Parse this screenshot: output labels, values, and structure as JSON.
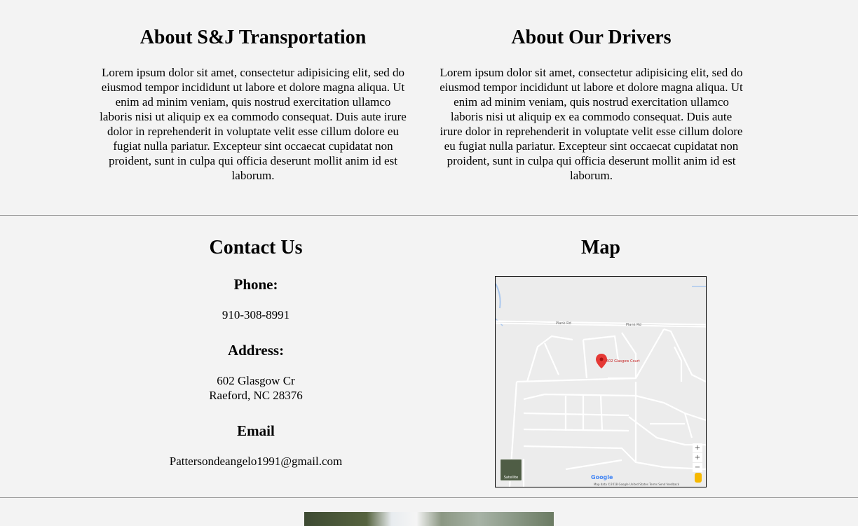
{
  "about": {
    "left_title": "About S&J Transportation",
    "left_text": "Lorem ipsum dolor sit amet, consectetur adipisicing elit, sed do eiusmod tempor incididunt ut labore et dolore magna aliqua. Ut enim ad minim veniam, quis nostrud exercitation ullamco laboris nisi ut aliquip ex ea commodo consequat. Duis aute irure dolor in reprehenderit in voluptate velit esse cillum dolore eu fugiat nulla pariatur. Excepteur sint occaecat cupidatat non proident, sunt in culpa qui officia deserunt mollit anim id est laborum.",
    "right_title": "About Our Drivers",
    "right_text": "Lorem ipsum dolor sit amet, consectetur adipisicing elit, sed do eiusmod tempor incididunt ut labore et dolore magna aliqua. Ut enim ad minim veniam, quis nostrud exercitation ullamco laboris nisi ut aliquip ex ea commodo consequat. Duis aute irure dolor in reprehenderit in voluptate velit esse cillum dolore eu fugiat nulla pariatur. Excepteur sint occaecat cupidatat non proident, sunt in culpa qui officia deserunt mollit anim id est laborum."
  },
  "contact": {
    "title": "Contact Us",
    "phone_label": "Phone:",
    "phone": "910-308-8991",
    "address_label": "Address:",
    "address_line1": "602 Glasgow Cr",
    "address_line2": "Raeford, NC 28376",
    "email_label": "Email",
    "email": "Pattersondeangelo1991@gmail.com"
  },
  "map": {
    "title": "Map",
    "marker_label": "602 Glasgow Court",
    "road_label": "Plank Rd",
    "zoom_in": "+",
    "zoom_out": "−",
    "satellite_label": "Satellite",
    "google_logo": "Google",
    "footer": "Map data ©2018 Google   United States   Terms   Send feedback"
  },
  "colors": {
    "background": "#f3f3f3",
    "divider": "#9a9a9a",
    "marker": "#e53935"
  },
  "icons": {
    "map_marker": "map-marker-icon",
    "pegman": "pegman-icon"
  }
}
